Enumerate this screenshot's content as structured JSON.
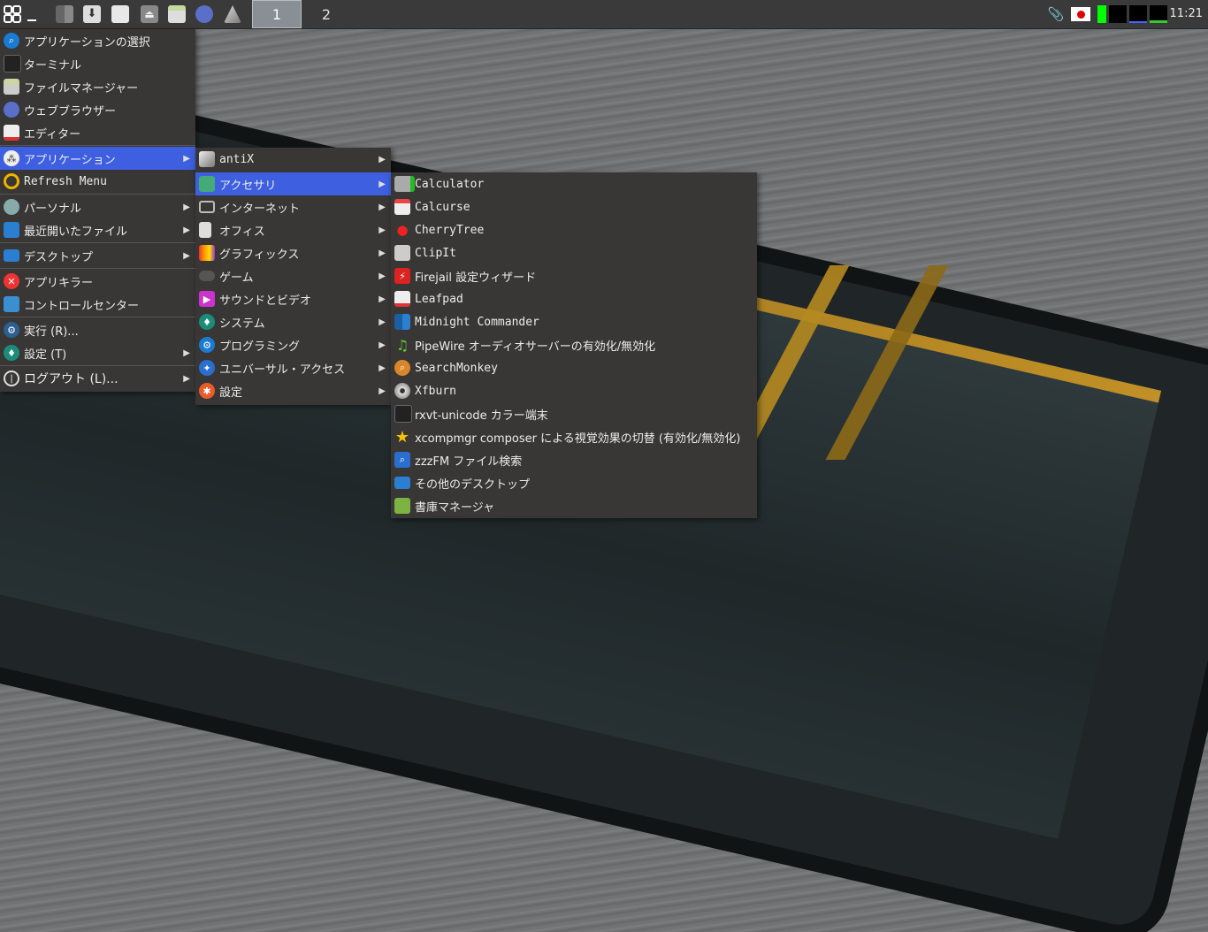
{
  "taskbar": {
    "workspaces": [
      "1",
      "2"
    ],
    "clock": "11:21"
  },
  "main_menu": {
    "items": [
      {
        "label": "アプリケーションの選択",
        "icon": "search-icon"
      },
      {
        "label": "ターミナル",
        "icon": "terminal-icon"
      },
      {
        "label": "ファイルマネージャー",
        "icon": "file-manager-icon"
      },
      {
        "label": "ウェブブラウザー",
        "icon": "web-browser-icon"
      },
      {
        "label": "エディター",
        "icon": "editor-icon"
      },
      {
        "label": "アプリケーション",
        "icon": "applications-icon"
      },
      {
        "label": "Refresh Menu",
        "icon": "refresh-icon"
      },
      {
        "label": "パーソナル",
        "icon": "personal-icon"
      },
      {
        "label": "最近開いたファイル",
        "icon": "recent-files-icon"
      },
      {
        "label": "デスクトップ",
        "icon": "desktop-icon"
      },
      {
        "label": "アプリキラー",
        "icon": "app-killer-icon"
      },
      {
        "label": "コントロールセンター",
        "icon": "control-center-icon"
      },
      {
        "label": "実行 (R)...",
        "icon": "run-icon"
      },
      {
        "label": "設定 (T)",
        "icon": "settings-icon"
      },
      {
        "label": "ログアウト (L)...",
        "icon": "logout-icon"
      }
    ]
  },
  "apps_menu": {
    "items": [
      {
        "label": "antiX",
        "icon": "antix-icon"
      },
      {
        "label": "アクセサリ",
        "icon": "accessories-icon"
      },
      {
        "label": "インターネット",
        "icon": "internet-icon"
      },
      {
        "label": "オフィス",
        "icon": "office-icon"
      },
      {
        "label": "グラフィックス",
        "icon": "graphics-icon"
      },
      {
        "label": "ゲーム",
        "icon": "games-icon"
      },
      {
        "label": "サウンドとビデオ",
        "icon": "sound-video-icon"
      },
      {
        "label": "システム",
        "icon": "system-icon"
      },
      {
        "label": "プログラミング",
        "icon": "programming-icon"
      },
      {
        "label": "ユニバーサル・アクセス",
        "icon": "universal-access-icon"
      },
      {
        "label": "設定",
        "icon": "settings-icon"
      }
    ]
  },
  "accessories_menu": {
    "items": [
      {
        "label": "Calculator",
        "icon": "calculator-icon"
      },
      {
        "label": "Calcurse",
        "icon": "calendar-icon"
      },
      {
        "label": "CherryTree",
        "icon": "cherry-icon"
      },
      {
        "label": "ClipIt",
        "icon": "clipboard-icon"
      },
      {
        "label": "Firejail 設定ウィザード",
        "icon": "firejail-icon"
      },
      {
        "label": "Leafpad",
        "icon": "leafpad-icon"
      },
      {
        "label": "Midnight Commander",
        "icon": "midnight-commander-icon"
      },
      {
        "label": "PipeWire オーディオサーバーの有効化/無効化",
        "icon": "music-note-icon"
      },
      {
        "label": "SearchMonkey",
        "icon": "search-monkey-icon"
      },
      {
        "label": "Xfburn",
        "icon": "disc-icon"
      },
      {
        "label": "rxvt-unicode カラー端末",
        "icon": "terminal-icon"
      },
      {
        "label": "xcompmgr composer による視覚効果の切替 (有効化/無効化)",
        "icon": "star-icon"
      },
      {
        "label": "zzzFM ファイル検索",
        "icon": "file-search-icon"
      },
      {
        "label": "その他のデスクトップ",
        "icon": "desktop-icon"
      },
      {
        "label": "書庫マネージャ",
        "icon": "archive-manager-icon"
      }
    ]
  }
}
